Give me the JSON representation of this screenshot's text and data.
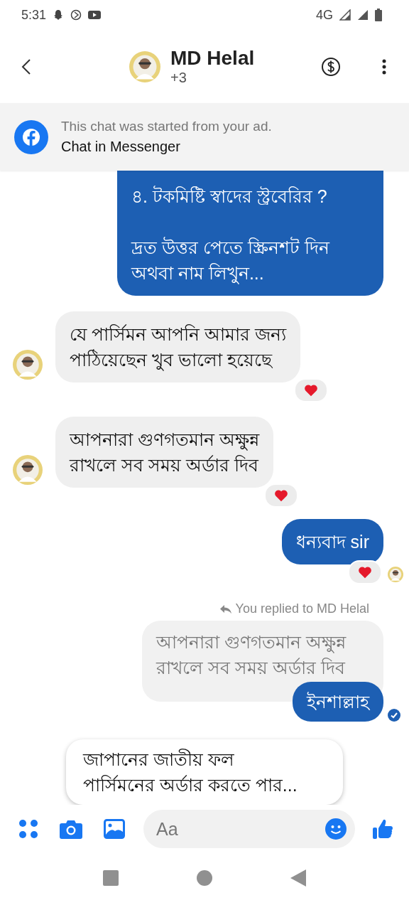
{
  "status_bar": {
    "time": "5:31",
    "network": "4G"
  },
  "header": {
    "title": "MD Helal",
    "subtitle": "+3"
  },
  "banner": {
    "text": "This chat was started from your ad.",
    "title": "Chat in Messenger"
  },
  "messages": [
    {
      "kind": "sent",
      "text": "৪. টকমিষ্টি স্বাদের স্ট্রবেরির ?\n\nদ্রত উত্তর পেতে স্ক্রিনশট দিন\nঅথবা নাম লিখুন...",
      "clipped": true
    },
    {
      "kind": "received",
      "text": "যে পার্সিমন আপনি আমার জন্য\nপাঠিয়েছেন খুব ভালো হয়েছে",
      "heart_reaction": true
    },
    {
      "kind": "received",
      "text": "আপনারা গুণগতমান অক্ষুন্ন\nরাখলে সব সময় অর্ডার দিব",
      "heart_reaction": true
    },
    {
      "kind": "sent",
      "text": "ধন্যবাদ sir",
      "heart_reaction": true,
      "seen": true
    },
    {
      "kind": "reply",
      "label": "You replied to MD Helal",
      "quoted": "আপনারা গুণগতমান অক্ষুন্ন\nরাখলে সব সময় অর্ডার দিব",
      "text": "ইনশাল্লাহ",
      "delivered": true
    }
  ],
  "popup": {
    "text": "জাপানের জাতীয় ফল\nপার্সিমনের অর্ডার করতে পার..."
  },
  "composer": {
    "placeholder": "Aa"
  }
}
